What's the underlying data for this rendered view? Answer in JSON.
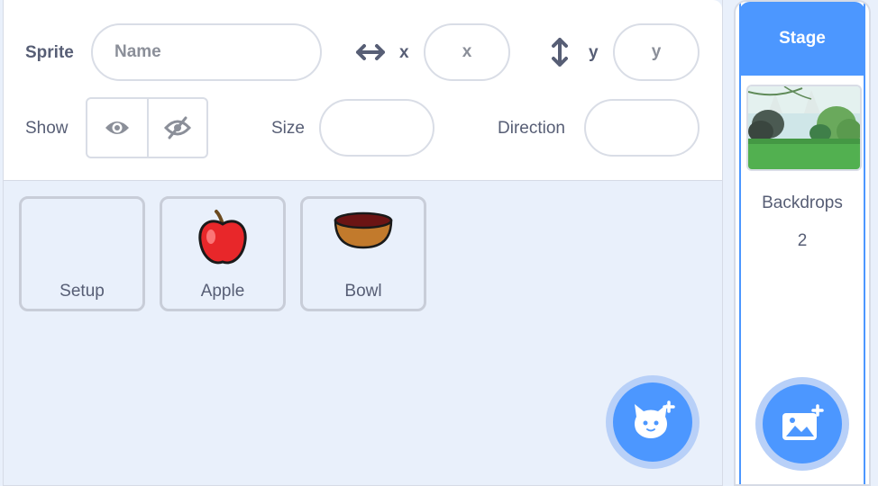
{
  "sprite_info": {
    "sprite_label": "Sprite",
    "name_placeholder": "Name",
    "x_label": "x",
    "x_placeholder": "x",
    "y_label": "y",
    "y_placeholder": "y",
    "show_label": "Show",
    "size_label": "Size",
    "direction_label": "Direction",
    "show_visible_icon": "eye-icon",
    "show_hidden_icon": "eye-slash-icon"
  },
  "sprites": [
    {
      "name": "Setup",
      "icon": ""
    },
    {
      "name": "Apple",
      "icon": "apple-icon"
    },
    {
      "name": "Bowl",
      "icon": "bowl-icon"
    }
  ],
  "choose_sprite_icon": "cat-plus-icon",
  "stage": {
    "header": "Stage",
    "backdrops_label": "Backdrops",
    "backdrops_count": "2",
    "choose_backdrop_icon": "image-plus-icon"
  },
  "colors": {
    "accent": "#4c97ff",
    "text": "#575e75",
    "panel_bg": "#e9f0fb"
  }
}
